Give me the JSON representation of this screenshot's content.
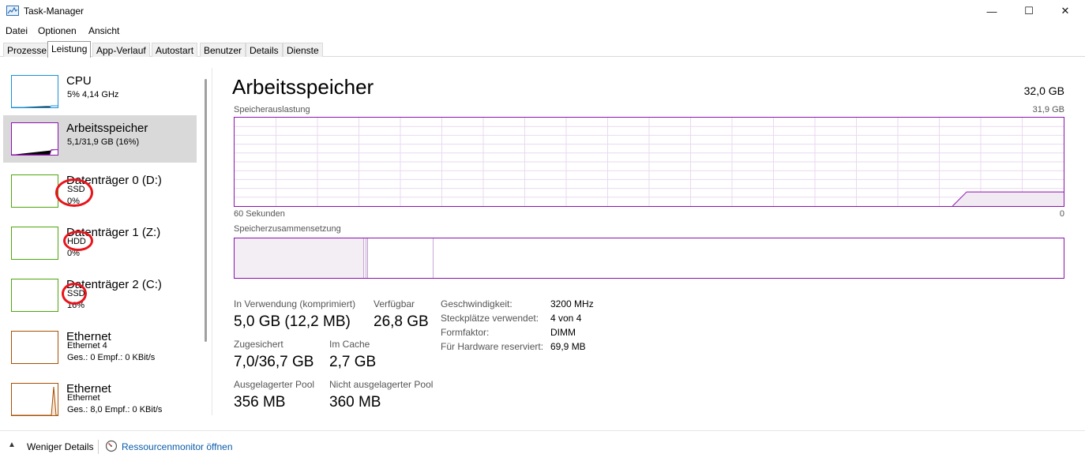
{
  "window": {
    "title": "Task-Manager",
    "icon": "task-manager-icon",
    "controls": {
      "minimize": "—",
      "maximize": "☐",
      "close": "✕"
    }
  },
  "menu": [
    "Datei",
    "Optionen",
    "Ansicht"
  ],
  "tabs": [
    "Prozesse",
    "Leistung",
    "App-Verlauf",
    "Autostart",
    "Benutzer",
    "Details",
    "Dienste"
  ],
  "active_tab": "Leistung",
  "sidebar": {
    "items": [
      {
        "name": "CPU",
        "sub": [
          "5% 4,14 GHz"
        ],
        "color": "#1a8fd6",
        "level": 0.05
      },
      {
        "name": "Arbeitsspeicher",
        "sub": [
          "5,1/31,9 GB (16%)"
        ],
        "color": "#8b12ae",
        "level": 0.16,
        "selected": true
      },
      {
        "name": "Datenträger 0 (D:)",
        "sub": [
          "SSD",
          "0%"
        ],
        "color": "#4da60c",
        "level": 0
      },
      {
        "name": "Datenträger 1 (Z:)",
        "sub": [
          "HDD",
          "0%"
        ],
        "color": "#4da60c",
        "level": 0
      },
      {
        "name": "Datenträger 2 (C:)",
        "sub": [
          "SSD",
          "16%"
        ],
        "color": "#4da60c",
        "level": 0
      },
      {
        "name": "Ethernet",
        "sub": [
          "Ethernet 4",
          "Ges.: 0 Empf.: 0 KBit/s"
        ],
        "color": "#a74f01",
        "level": 0
      },
      {
        "name": "Ethernet",
        "sub": [
          "Ethernet",
          "Ges.: 8,0 Empf.: 0 KBit/s"
        ],
        "color": "#a74f01",
        "level": 0
      }
    ]
  },
  "main": {
    "title": "Arbeitsspeicher",
    "total": "32,0 GB",
    "usage_graph": {
      "label": "Speicherauslastung",
      "max": "31,9 GB",
      "x_left": "60 Sekunden",
      "x_right": "0",
      "line_color": "#8b12ae"
    },
    "composition": {
      "label": "Speicherzusammensetzung"
    },
    "stats": [
      {
        "label": "In Verwendung (komprimiert)",
        "value": "5,0 GB (12,2 MB)"
      },
      {
        "label": "Verfügbar",
        "value": "26,8 GB"
      },
      {
        "label": "Zugesichert",
        "value": "7,0/36,7 GB"
      },
      {
        "label": "Im Cache",
        "value": "2,7 GB"
      },
      {
        "label": "Ausgelagerter Pool",
        "value": "356 MB"
      },
      {
        "label": "Nicht ausgelagerter Pool",
        "value": "360 MB"
      }
    ],
    "details": [
      {
        "label": "Geschwindigkeit:",
        "value": "3200 MHz"
      },
      {
        "label": "Steckplätze verwendet:",
        "value": "4 von 4"
      },
      {
        "label": "Formfaktor:",
        "value": "DIMM"
      },
      {
        "label": "Für Hardware reserviert:",
        "value": "69,9 MB"
      }
    ]
  },
  "footer": {
    "fewer_details": "Weniger Details",
    "resource_monitor": "Ressourcenmonitor öffnen"
  },
  "annotation": {
    "color": "#e8141b"
  }
}
